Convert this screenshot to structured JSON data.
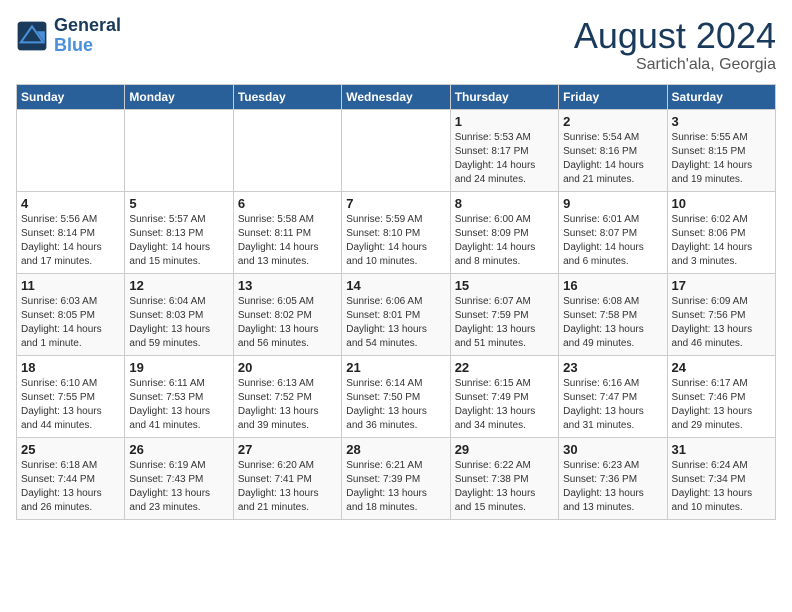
{
  "header": {
    "logo_line1": "General",
    "logo_line2": "Blue",
    "month_title": "August 2024",
    "location": "Sartich'ala, Georgia"
  },
  "weekdays": [
    "Sunday",
    "Monday",
    "Tuesday",
    "Wednesday",
    "Thursday",
    "Friday",
    "Saturday"
  ],
  "weeks": [
    [
      {
        "day": "",
        "info": ""
      },
      {
        "day": "",
        "info": ""
      },
      {
        "day": "",
        "info": ""
      },
      {
        "day": "",
        "info": ""
      },
      {
        "day": "1",
        "info": "Sunrise: 5:53 AM\nSunset: 8:17 PM\nDaylight: 14 hours\nand 24 minutes."
      },
      {
        "day": "2",
        "info": "Sunrise: 5:54 AM\nSunset: 8:16 PM\nDaylight: 14 hours\nand 21 minutes."
      },
      {
        "day": "3",
        "info": "Sunrise: 5:55 AM\nSunset: 8:15 PM\nDaylight: 14 hours\nand 19 minutes."
      }
    ],
    [
      {
        "day": "4",
        "info": "Sunrise: 5:56 AM\nSunset: 8:14 PM\nDaylight: 14 hours\nand 17 minutes."
      },
      {
        "day": "5",
        "info": "Sunrise: 5:57 AM\nSunset: 8:13 PM\nDaylight: 14 hours\nand 15 minutes."
      },
      {
        "day": "6",
        "info": "Sunrise: 5:58 AM\nSunset: 8:11 PM\nDaylight: 14 hours\nand 13 minutes."
      },
      {
        "day": "7",
        "info": "Sunrise: 5:59 AM\nSunset: 8:10 PM\nDaylight: 14 hours\nand 10 minutes."
      },
      {
        "day": "8",
        "info": "Sunrise: 6:00 AM\nSunset: 8:09 PM\nDaylight: 14 hours\nand 8 minutes."
      },
      {
        "day": "9",
        "info": "Sunrise: 6:01 AM\nSunset: 8:07 PM\nDaylight: 14 hours\nand 6 minutes."
      },
      {
        "day": "10",
        "info": "Sunrise: 6:02 AM\nSunset: 8:06 PM\nDaylight: 14 hours\nand 3 minutes."
      }
    ],
    [
      {
        "day": "11",
        "info": "Sunrise: 6:03 AM\nSunset: 8:05 PM\nDaylight: 14 hours\nand 1 minute."
      },
      {
        "day": "12",
        "info": "Sunrise: 6:04 AM\nSunset: 8:03 PM\nDaylight: 13 hours\nand 59 minutes."
      },
      {
        "day": "13",
        "info": "Sunrise: 6:05 AM\nSunset: 8:02 PM\nDaylight: 13 hours\nand 56 minutes."
      },
      {
        "day": "14",
        "info": "Sunrise: 6:06 AM\nSunset: 8:01 PM\nDaylight: 13 hours\nand 54 minutes."
      },
      {
        "day": "15",
        "info": "Sunrise: 6:07 AM\nSunset: 7:59 PM\nDaylight: 13 hours\nand 51 minutes."
      },
      {
        "day": "16",
        "info": "Sunrise: 6:08 AM\nSunset: 7:58 PM\nDaylight: 13 hours\nand 49 minutes."
      },
      {
        "day": "17",
        "info": "Sunrise: 6:09 AM\nSunset: 7:56 PM\nDaylight: 13 hours\nand 46 minutes."
      }
    ],
    [
      {
        "day": "18",
        "info": "Sunrise: 6:10 AM\nSunset: 7:55 PM\nDaylight: 13 hours\nand 44 minutes."
      },
      {
        "day": "19",
        "info": "Sunrise: 6:11 AM\nSunset: 7:53 PM\nDaylight: 13 hours\nand 41 minutes."
      },
      {
        "day": "20",
        "info": "Sunrise: 6:13 AM\nSunset: 7:52 PM\nDaylight: 13 hours\nand 39 minutes."
      },
      {
        "day": "21",
        "info": "Sunrise: 6:14 AM\nSunset: 7:50 PM\nDaylight: 13 hours\nand 36 minutes."
      },
      {
        "day": "22",
        "info": "Sunrise: 6:15 AM\nSunset: 7:49 PM\nDaylight: 13 hours\nand 34 minutes."
      },
      {
        "day": "23",
        "info": "Sunrise: 6:16 AM\nSunset: 7:47 PM\nDaylight: 13 hours\nand 31 minutes."
      },
      {
        "day": "24",
        "info": "Sunrise: 6:17 AM\nSunset: 7:46 PM\nDaylight: 13 hours\nand 29 minutes."
      }
    ],
    [
      {
        "day": "25",
        "info": "Sunrise: 6:18 AM\nSunset: 7:44 PM\nDaylight: 13 hours\nand 26 minutes."
      },
      {
        "day": "26",
        "info": "Sunrise: 6:19 AM\nSunset: 7:43 PM\nDaylight: 13 hours\nand 23 minutes."
      },
      {
        "day": "27",
        "info": "Sunrise: 6:20 AM\nSunset: 7:41 PM\nDaylight: 13 hours\nand 21 minutes."
      },
      {
        "day": "28",
        "info": "Sunrise: 6:21 AM\nSunset: 7:39 PM\nDaylight: 13 hours\nand 18 minutes."
      },
      {
        "day": "29",
        "info": "Sunrise: 6:22 AM\nSunset: 7:38 PM\nDaylight: 13 hours\nand 15 minutes."
      },
      {
        "day": "30",
        "info": "Sunrise: 6:23 AM\nSunset: 7:36 PM\nDaylight: 13 hours\nand 13 minutes."
      },
      {
        "day": "31",
        "info": "Sunrise: 6:24 AM\nSunset: 7:34 PM\nDaylight: 13 hours\nand 10 minutes."
      }
    ]
  ]
}
